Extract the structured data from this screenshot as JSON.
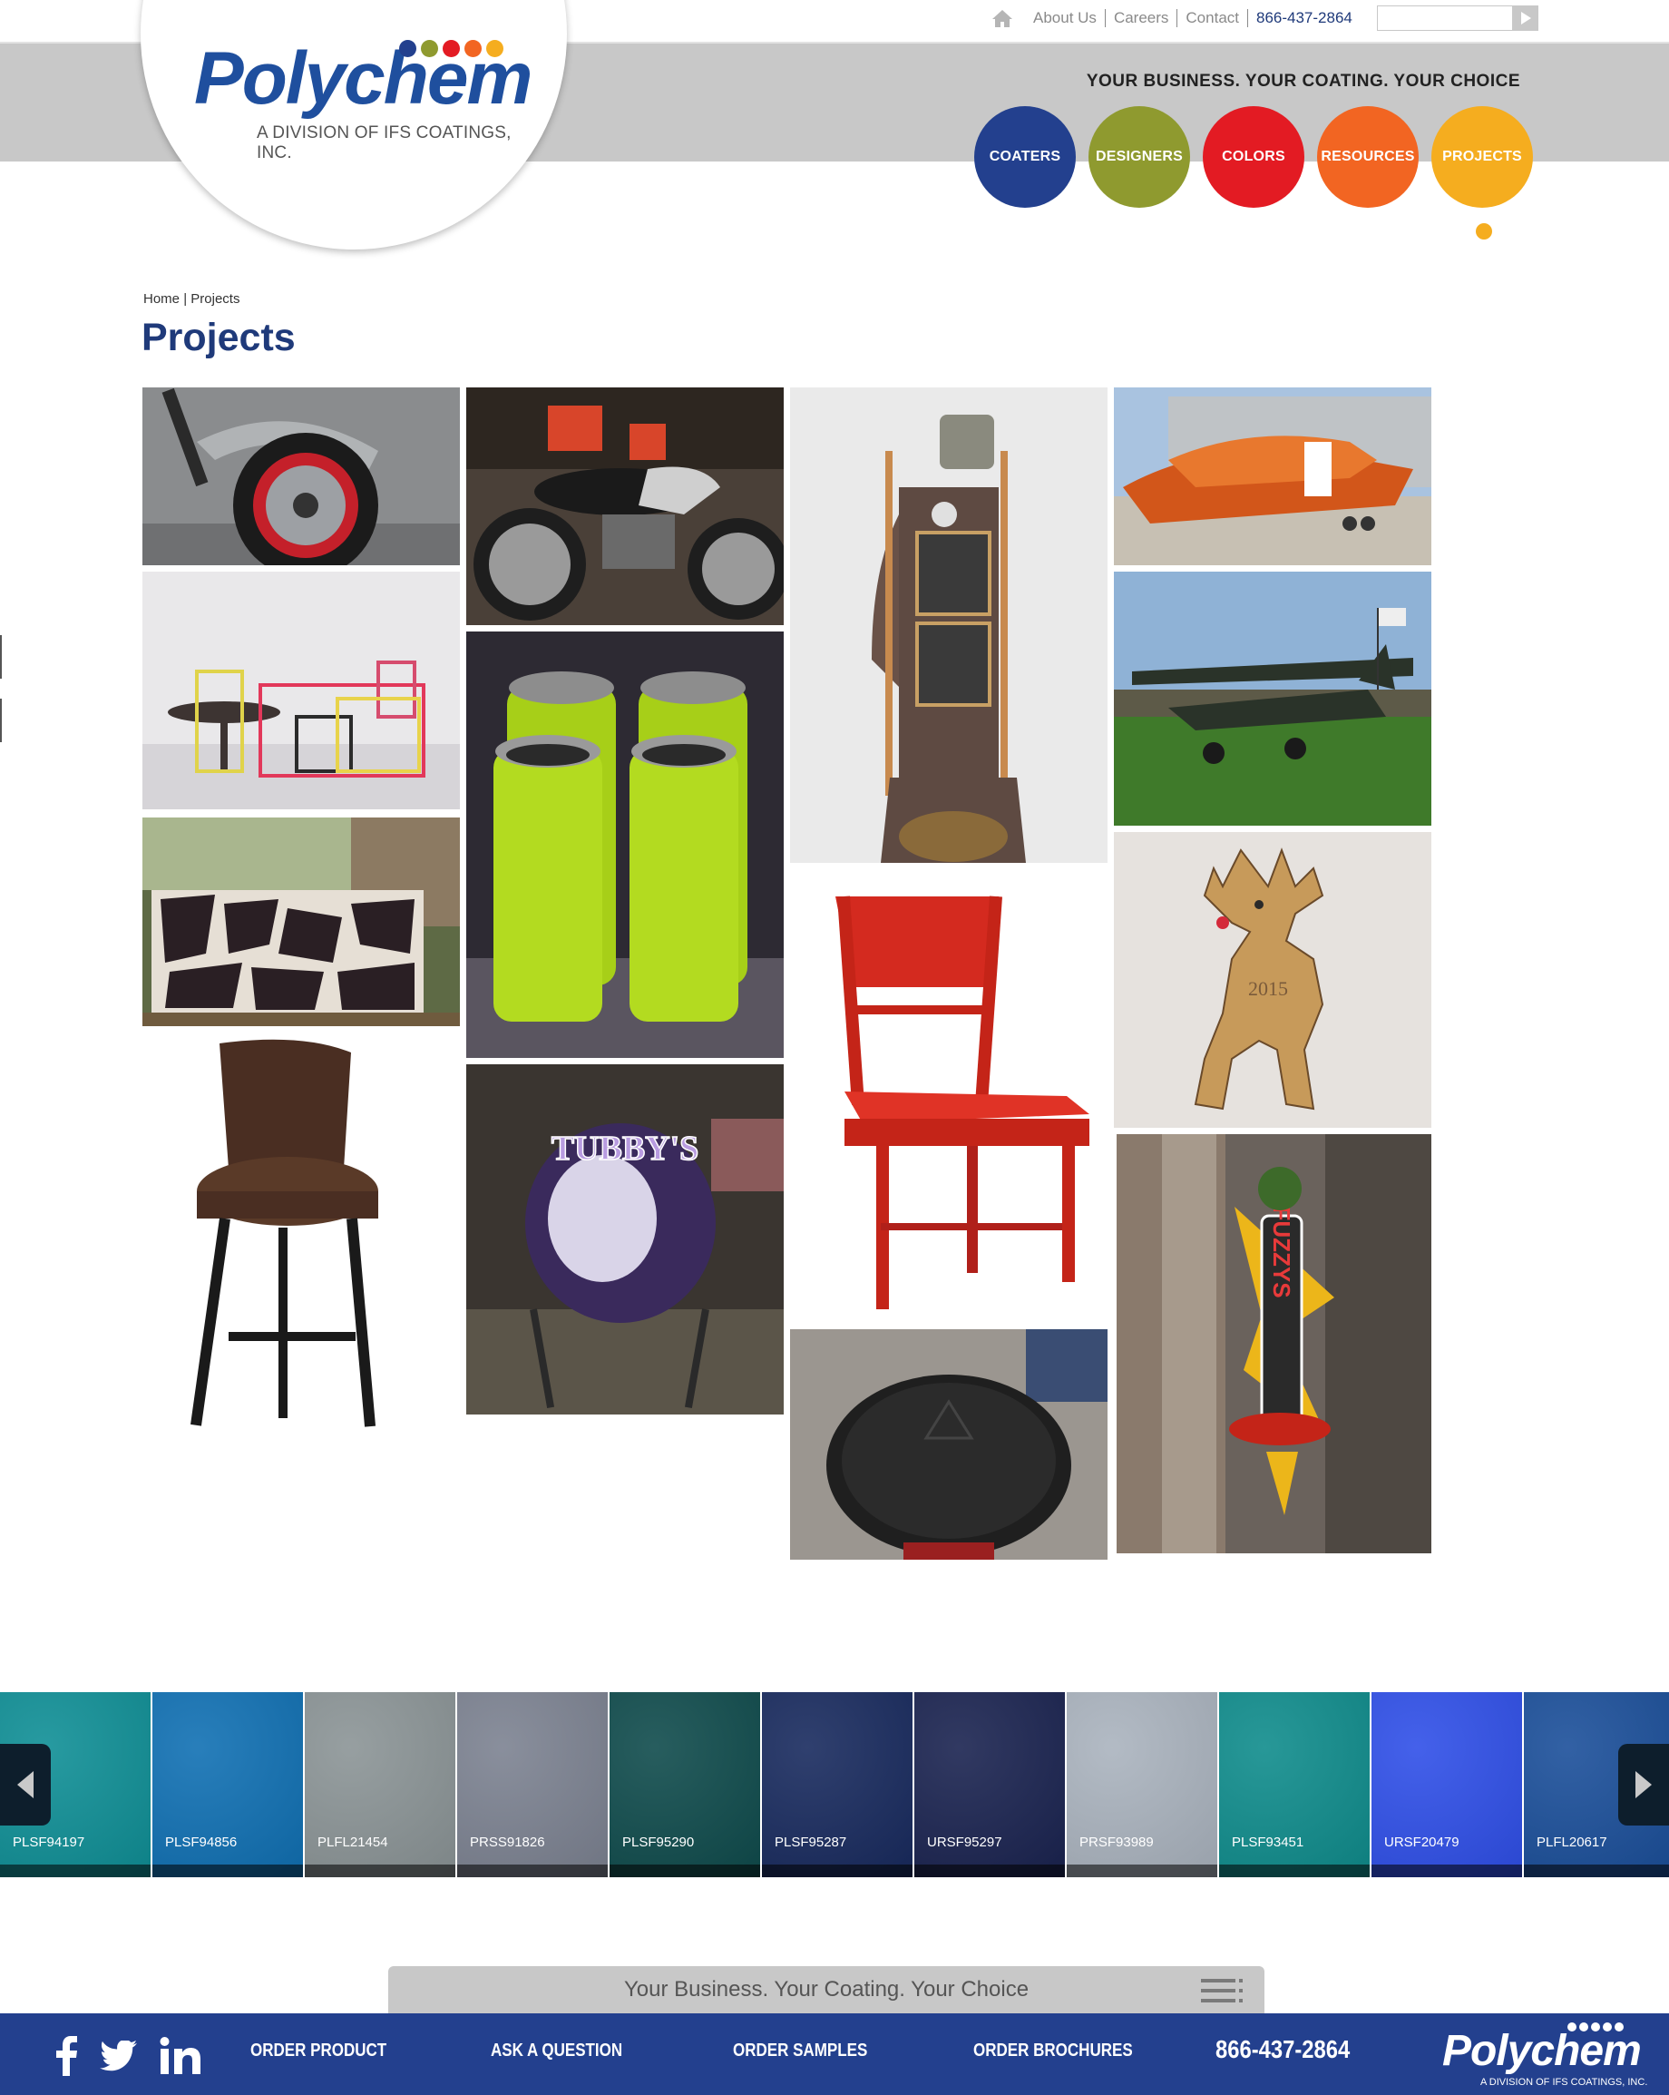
{
  "header": {
    "utility_links": [
      "About Us",
      "Careers",
      "Contact"
    ],
    "phone": "866-437-2864",
    "search": {
      "placeholder": ""
    },
    "slogan": "YOUR BUSINESS. YOUR COATING. YOUR CHOICE"
  },
  "logo": {
    "wordmark": "Polychem",
    "tagline": "A DIVISION OF IFS COATINGS, INC.",
    "dot_colors": [
      "#23408e",
      "#8f9a2f",
      "#e31b23",
      "#f26522",
      "#f5ad1f"
    ]
  },
  "nav": [
    {
      "label": "COATERS",
      "color": "#23408e"
    },
    {
      "label": "DESIGNERS",
      "color": "#8f9a2f"
    },
    {
      "label": "COLORS",
      "color": "#e31b23"
    },
    {
      "label": "RESOURCES",
      "color": "#f26522"
    },
    {
      "label": "PROJECTS",
      "color": "#f5ad1f"
    }
  ],
  "active_nav": "PROJECTS",
  "breadcrumb": {
    "home": "Home",
    "separator": "|",
    "current": "Projects"
  },
  "page_title": "Projects",
  "projects": [
    {
      "icon": "motorcycle-wheel-image"
    },
    {
      "icon": "honda-motorcycle-image"
    },
    {
      "icon": "steampunk-tower-image"
    },
    {
      "icon": "orange-boat-hull-image"
    },
    {
      "icon": "colored-table-frames-image"
    },
    {
      "icon": "green-tumblers-image"
    },
    {
      "icon": "vintage-airplane-image"
    },
    {
      "icon": "geometric-gate-image"
    },
    {
      "icon": "red-chair-image"
    },
    {
      "icon": "reindeer-ornament-image",
      "text": "2015"
    },
    {
      "icon": "bar-stool-image"
    },
    {
      "icon": "tubbys-sign-image",
      "text": "TUBBY'S"
    },
    {
      "icon": "fuzzys-sign-image",
      "text": "FUZZYS"
    },
    {
      "icon": "stool-seat-image"
    }
  ],
  "swatches": [
    {
      "code": "PLSF94197",
      "color": "#0f8f96"
    },
    {
      "code": "PLSF94856",
      "color": "#1070b3"
    },
    {
      "code": "PLFL21454",
      "color": "#8b9496"
    },
    {
      "code": "PRSS91826",
      "color": "#7c8291"
    },
    {
      "code": "PLSF95290",
      "color": "#0f4b4c"
    },
    {
      "code": "PLSF95287",
      "color": "#182a5e"
    },
    {
      "code": "URSF95297",
      "color": "#1a2350"
    },
    {
      "code": "PRSF93989",
      "color": "#aab3be"
    },
    {
      "code": "PLSF93451",
      "color": "#0f8c8c"
    },
    {
      "code": "URSF20479",
      "color": "#2f4fe8"
    },
    {
      "code": "PLFL20617",
      "color": "#1b4f9a"
    }
  ],
  "tagline_bar": "Your Business. Your Coating. Your Choice",
  "footer": {
    "links": [
      "ORDER PRODUCT",
      "ASK A QUESTION",
      "ORDER SAMPLES",
      "ORDER BROCHURES"
    ],
    "phone": "866-437-2864",
    "social": [
      "facebook-icon",
      "twitter-icon",
      "linkedin-icon"
    ],
    "logo_word": "Polychem",
    "logo_tag": "A DIVISION OF IFS COATINGS, INC."
  }
}
